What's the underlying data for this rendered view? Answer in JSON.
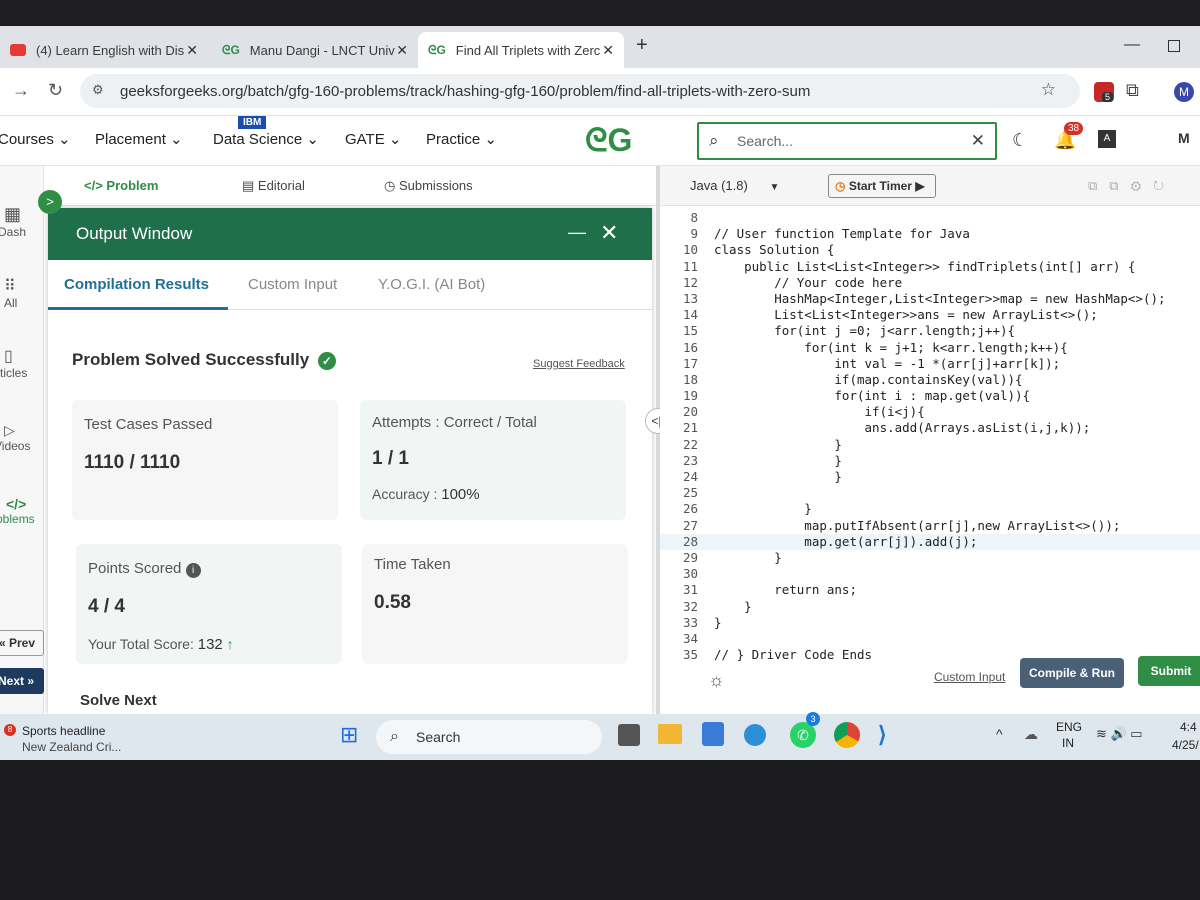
{
  "browser": {
    "tabs": [
      {
        "title": "(4) Learn English with Dis",
        "favicon": "youtube-icon"
      },
      {
        "title": "Manu Dangi - LNCT Univ",
        "favicon": "gfg-icon"
      },
      {
        "title": "Find All Triplets with Zerc",
        "favicon": "gfg-icon"
      }
    ],
    "url": "geeksforgeeks.org/batch/gfg-160-problems/track/hashing-gfg-160/problem/find-all-triplets-with-zero-sum",
    "ext_badge": "5",
    "profile": "M"
  },
  "site_nav": {
    "items": [
      "Courses",
      "Placement",
      "Data Science",
      "GATE",
      "Practice"
    ],
    "ibm_badge": "IBM",
    "logo": "ᘓG",
    "search_placeholder": "Search...",
    "notif_count": "38",
    "profile": "M"
  },
  "sidebar": {
    "items": [
      "Dash",
      "All",
      "Articles",
      "Videos",
      "Problems"
    ],
    "prev_label": "« Prev",
    "next_label": "Next »"
  },
  "problem_tabs": [
    "</> Problem",
    "Editorial",
    "Submissions"
  ],
  "output_window": {
    "title": "Output Window",
    "tabs": [
      "Compilation Results",
      "Custom Input",
      "Y.O.G.I. (AI Bot)"
    ],
    "status": "Problem Solved Successfully",
    "suggest_feedback": "Suggest Feedback",
    "test_cases_label": "Test Cases Passed",
    "test_cases_value": "1110 / 1110",
    "attempts_label": "Attempts : Correct / Total",
    "attempts_value": "1 / 1",
    "accuracy_label": "Accuracy :",
    "accuracy_value": "100%",
    "points_label": "Points Scored",
    "points_value": "4 / 4",
    "total_score_label": "Your Total Score:",
    "total_score_value": "132",
    "time_label": "Time Taken",
    "time_value": "0.58",
    "solve_next": "Solve Next"
  },
  "editor": {
    "language": "Java (1.8)",
    "timer_label": "Start Timer",
    "custom_input": "Custom Input",
    "compile_run": "Compile & Run",
    "submit": "Submit",
    "lines": [
      {
        "n": "8",
        "t": ""
      },
      {
        "n": "9",
        "t": "// User function Template for Java"
      },
      {
        "n": "10",
        "t": "class Solution {"
      },
      {
        "n": "11",
        "t": "    public List<List<Integer>> findTriplets(int[] arr) {"
      },
      {
        "n": "12",
        "t": "        // Your code here"
      },
      {
        "n": "13",
        "t": "        HashMap<Integer,List<Integer>>map = new HashMap<>();"
      },
      {
        "n": "14",
        "t": "        List<List<Integer>>ans = new ArrayList<>();"
      },
      {
        "n": "15",
        "t": "        for(int j =0; j<arr.length;j++){"
      },
      {
        "n": "16",
        "t": "            for(int k = j+1; k<arr.length;k++){"
      },
      {
        "n": "17",
        "t": "                int val = -1 *(arr[j]+arr[k]);"
      },
      {
        "n": "18",
        "t": "                if(map.containsKey(val)){"
      },
      {
        "n": "19",
        "t": "                for(int i : map.get(val)){"
      },
      {
        "n": "20",
        "t": "                    if(i<j){"
      },
      {
        "n": "21",
        "t": "                    ans.add(Arrays.asList(i,j,k));"
      },
      {
        "n": "22",
        "t": "                }"
      },
      {
        "n": "23",
        "t": "                }"
      },
      {
        "n": "24",
        "t": "                }"
      },
      {
        "n": "25",
        "t": ""
      },
      {
        "n": "26",
        "t": "            }"
      },
      {
        "n": "27",
        "t": "            map.putIfAbsent(arr[j],new ArrayList<>());"
      },
      {
        "n": "28",
        "t": "            map.get(arr[j]).add(j);"
      },
      {
        "n": "29",
        "t": "        }"
      },
      {
        "n": "30",
        "t": ""
      },
      {
        "n": "31",
        "t": "        return ans;"
      },
      {
        "n": "32",
        "t": "    }"
      },
      {
        "n": "33",
        "t": "}"
      },
      {
        "n": "34",
        "t": ""
      },
      {
        "n": "35",
        "t": "// } Driver Code Ends"
      }
    ]
  },
  "taskbar": {
    "news_title": "Sports headline",
    "news_sub": "New Zealand Cri...",
    "news_badge": "8",
    "search": "Search",
    "whatsapp_badge": "3",
    "lang": "ENG",
    "region": "IN",
    "time": "4:4",
    "date": "4/25/"
  },
  "colors": {
    "gfg_green": "#2f8d46",
    "output_header": "#1f6f4a",
    "notif_red": "#d93025"
  }
}
